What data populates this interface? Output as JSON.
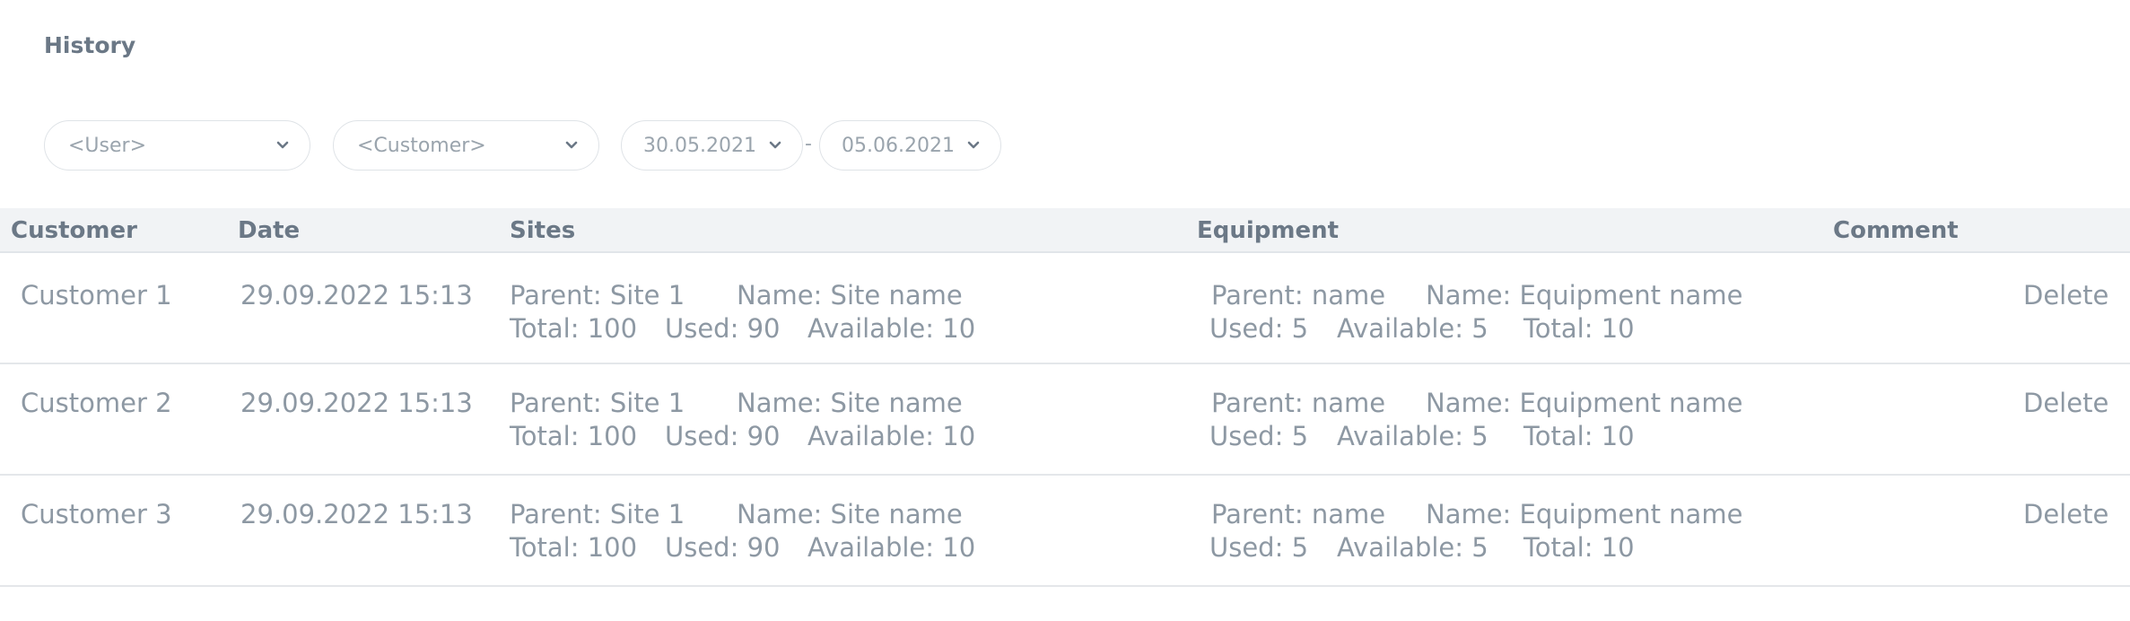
{
  "page": {
    "title": "History"
  },
  "filters": {
    "user": "<User>",
    "customer": "<Customer>",
    "date_from": "30.05.2021",
    "date_separator": "-",
    "date_to": "05.06.2021"
  },
  "table": {
    "headers": {
      "customer": "Customer",
      "date": "Date",
      "sites": "Sites",
      "equipment": "Equipment",
      "comment": "Comment"
    },
    "rows": [
      {
        "customer": "Customer 1",
        "date": "29.09.2022 15:13",
        "sites": {
          "parent": "Parent: Site 1",
          "name": "Name: Site name",
          "total": "Total: 100",
          "used": "Used: 90",
          "available": "Available: 10"
        },
        "equipment": {
          "parent": "Parent: name",
          "name": "Name: Equipment name",
          "used": "Used: 5",
          "available": "Available: 5",
          "total": "Total: 10"
        },
        "action": "Delete"
      },
      {
        "customer": "Customer 2",
        "date": "29.09.2022 15:13",
        "sites": {
          "parent": "Parent: Site 1",
          "name": "Name: Site name",
          "total": "Total: 100",
          "used": "Used: 90",
          "available": "Available: 10"
        },
        "equipment": {
          "parent": "Parent: name",
          "name": "Name: Equipment name",
          "used": "Used: 5",
          "available": "Available: 5",
          "total": "Total: 10"
        },
        "action": "Delete"
      },
      {
        "customer": "Customer 3",
        "date": "29.09.2022 15:13",
        "sites": {
          "parent": "Parent: Site 1",
          "name": "Name: Site name",
          "total": "Total: 100",
          "used": "Used: 90",
          "available": "Available: 10"
        },
        "equipment": {
          "parent": "Parent: name",
          "name": "Name: Equipment name",
          "used": "Used: 5",
          "available": "Available: 5",
          "total": "Total: 10"
        },
        "action": "Delete"
      }
    ]
  }
}
